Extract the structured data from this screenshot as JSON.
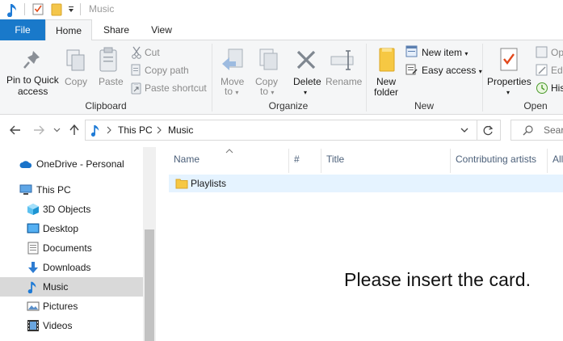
{
  "window": {
    "title": "Music"
  },
  "tabs": [
    {
      "label": "File"
    },
    {
      "label": "Home"
    },
    {
      "label": "Share"
    },
    {
      "label": "View"
    }
  ],
  "ribbon": {
    "clipboard": {
      "group_label": "Clipboard",
      "pin_line1": "Pin to Quick",
      "pin_line2": "access",
      "copy": "Copy",
      "paste": "Paste",
      "cut": "Cut",
      "copy_path": "Copy path",
      "paste_shortcut": "Paste shortcut"
    },
    "organize": {
      "group_label": "Organize",
      "move_to_line1": "Move",
      "move_to_line2": "to",
      "copy_to_line1": "Copy",
      "copy_to_line2": "to",
      "delete": "Delete",
      "rename": "Rename"
    },
    "new": {
      "group_label": "New",
      "new_folder_line1": "New",
      "new_folder_line2": "folder",
      "new_item": "New item",
      "easy_access": "Easy access"
    },
    "open": {
      "group_label": "Open",
      "properties": "Properties",
      "open_partial": "Op",
      "edit_partial": "Edi",
      "history_partial": "His"
    }
  },
  "address": {
    "crumbs": [
      "This PC",
      "Music"
    ],
    "search_placeholder": "Searc"
  },
  "nav": {
    "items": [
      {
        "label": "OneDrive - Personal",
        "icon": "onedrive-icon"
      },
      {
        "label": "This PC",
        "icon": "this-pc-icon"
      },
      {
        "label": "3D Objects",
        "icon": "3d-objects-icon"
      },
      {
        "label": "Desktop",
        "icon": "desktop-icon"
      },
      {
        "label": "Documents",
        "icon": "documents-icon"
      },
      {
        "label": "Downloads",
        "icon": "downloads-icon"
      },
      {
        "label": "Music",
        "icon": "music-icon",
        "selected": true
      },
      {
        "label": "Pictures",
        "icon": "pictures-icon"
      },
      {
        "label": "Videos",
        "icon": "videos-icon"
      }
    ]
  },
  "filelist": {
    "columns": [
      "Name",
      "#",
      "Title",
      "Contributing artists",
      "All"
    ],
    "rows": [
      {
        "name": "Playlists",
        "icon": "folder-icon"
      }
    ]
  },
  "overlay_message": "Please insert the card.",
  "colors": {
    "accent": "#1979ca",
    "ribbon_bg": "#f5f6f7",
    "selection": "#d9d9d9",
    "row_hover": "#e5f3ff",
    "column_header_text": "#4c607a"
  }
}
